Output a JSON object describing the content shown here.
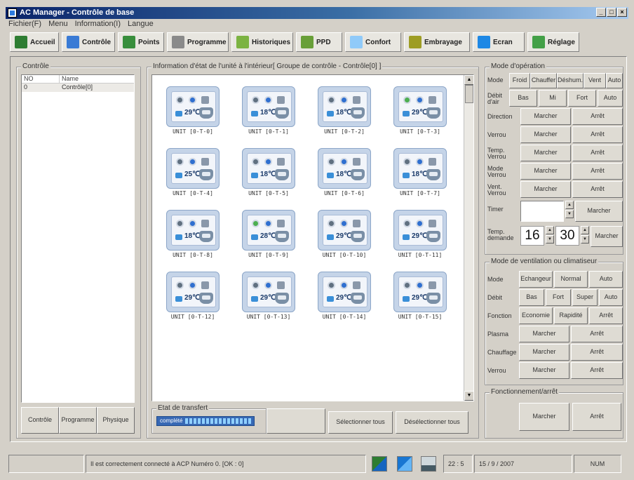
{
  "window": {
    "title": "AC Manager - Contrôle de base",
    "btn_min": "_",
    "btn_max": "□",
    "btn_close": "×"
  },
  "menu": [
    "Fichier(F)",
    "Menu",
    "Information(I)",
    "Langue"
  ],
  "toolbar": [
    {
      "label": "Accueil",
      "icon": "home-icon",
      "color": "#2e7d32"
    },
    {
      "label": "Contrôle",
      "icon": "grid-icon",
      "color": "#3a7bd5"
    },
    {
      "label": "Points",
      "icon": "bar-chart-icon",
      "color": "#388e3c"
    },
    {
      "label": "Programme",
      "icon": "clock-icon",
      "color": "#8a8a8a"
    },
    {
      "label": "Historiques",
      "icon": "history-icon",
      "color": "#7cb342"
    },
    {
      "label": "PPD",
      "icon": "ppd-icon",
      "color": "#689f38"
    },
    {
      "label": "Confort",
      "icon": "comfort-icon",
      "color": "#90caf9"
    },
    {
      "label": "Embrayage",
      "icon": "interlock-icon",
      "color": "#9e9d24"
    },
    {
      "label": "Ecran",
      "icon": "screen-icon",
      "color": "#1e88e5"
    },
    {
      "label": "Réglage",
      "icon": "settings-icon",
      "color": "#43a047"
    }
  ],
  "left_panel": {
    "title": "Contrôle",
    "col_no": "NO",
    "col_name": "Name",
    "rows": [
      {
        "no": "0",
        "name": "Contrôle[0]"
      }
    ],
    "tabs": [
      "Contrôle",
      "Programme",
      "Physique"
    ]
  },
  "center": {
    "title": "Information d'état de l'unité à l'intérieur[ Groupe de contrôle - Contrôle[0] ]",
    "units": [
      {
        "name": "UNIT [0-T-0]",
        "temp": "29℃",
        "status": "gray"
      },
      {
        "name": "UNIT [0-T-1]",
        "temp": "18℃",
        "status": "gray"
      },
      {
        "name": "UNIT [0-T-2]",
        "temp": "18℃",
        "status": "gray"
      },
      {
        "name": "UNIT [0-T-3]",
        "temp": "29℃",
        "status": "green"
      },
      {
        "name": "UNIT [0-T-4]",
        "temp": "25℃",
        "status": "gray"
      },
      {
        "name": "UNIT [0-T-5]",
        "temp": "18℃",
        "status": "gray"
      },
      {
        "name": "UNIT [0-T-6]",
        "temp": "18℃",
        "status": "gray"
      },
      {
        "name": "UNIT [0-T-7]",
        "temp": "18℃",
        "status": "gray"
      },
      {
        "name": "UNIT [0-T-8]",
        "temp": "18℃",
        "status": "gray"
      },
      {
        "name": "UNIT [0-T-9]",
        "temp": "28℃",
        "status": "green"
      },
      {
        "name": "UNIT [0-T-10]",
        "temp": "29℃",
        "status": "gray"
      },
      {
        "name": "UNIT [0-T-11]",
        "temp": "29℃",
        "status": "gray"
      },
      {
        "name": "UNIT [0-T-12]",
        "temp": "29℃",
        "status": "gray"
      },
      {
        "name": "UNIT [0-T-13]",
        "temp": "29℃",
        "status": "gray"
      },
      {
        "name": "UNIT [0-T-14]",
        "temp": "29℃",
        "status": "gray"
      },
      {
        "name": "UNIT [0-T-15]",
        "temp": "29℃",
        "status": "gray"
      }
    ],
    "transfer_title": "Etat de transfert",
    "transfer_text": "complété",
    "transfer_progress": 1.0,
    "select_all": "Sélectionner tous",
    "deselect_all": "Désélectionner tous"
  },
  "operation": {
    "title": "Mode d'opération",
    "mode_label": "Mode",
    "modes": [
      "Froid",
      "Chauffer",
      "Déshum.",
      "Vent",
      "Auto"
    ],
    "debit_label": "Débit d'air",
    "debits": [
      "Bas",
      "Mi",
      "Fort",
      "Auto"
    ],
    "direction_label": "Direction",
    "verrou_label": "Verrou",
    "temp_verrou_label": "Temp. Verrou",
    "mode_verrou_label": "Mode Verrou",
    "vent_verrou_label": "Vent. Verrou",
    "marcher": "Marcher",
    "arret": "Arrêt",
    "timer_label": "Timer",
    "temp_label": "Temp. demande",
    "temp_int": "16",
    "temp_dec": "30"
  },
  "ventilation": {
    "title": "Mode de ventilation ou climatiseur",
    "mode_label": "Mode",
    "modes": [
      "Echangeur",
      "Normal",
      "Auto"
    ],
    "debit_label": "Débit",
    "debits": [
      "Bas",
      "Fort",
      "Super",
      "Auto"
    ],
    "fonction_label": "Fonction",
    "fonctions": [
      "Economie",
      "Rapidité",
      "Arrêt"
    ],
    "plasma_label": "Plasma",
    "chauffage_label": "Chauffage",
    "verrou_label": "Verrou",
    "marcher": "Marcher",
    "arret": "Arrêt"
  },
  "onoff": {
    "title": "Fonctionnement/arrêt",
    "marcher": "Marcher",
    "arret": "Arrêt"
  },
  "status": {
    "message": "Il est correctement connecté à ACP Numéro 0. [OK : 0]",
    "time": "22 : 5",
    "date": "15 / 9 / 2007",
    "num": "NUM"
  }
}
